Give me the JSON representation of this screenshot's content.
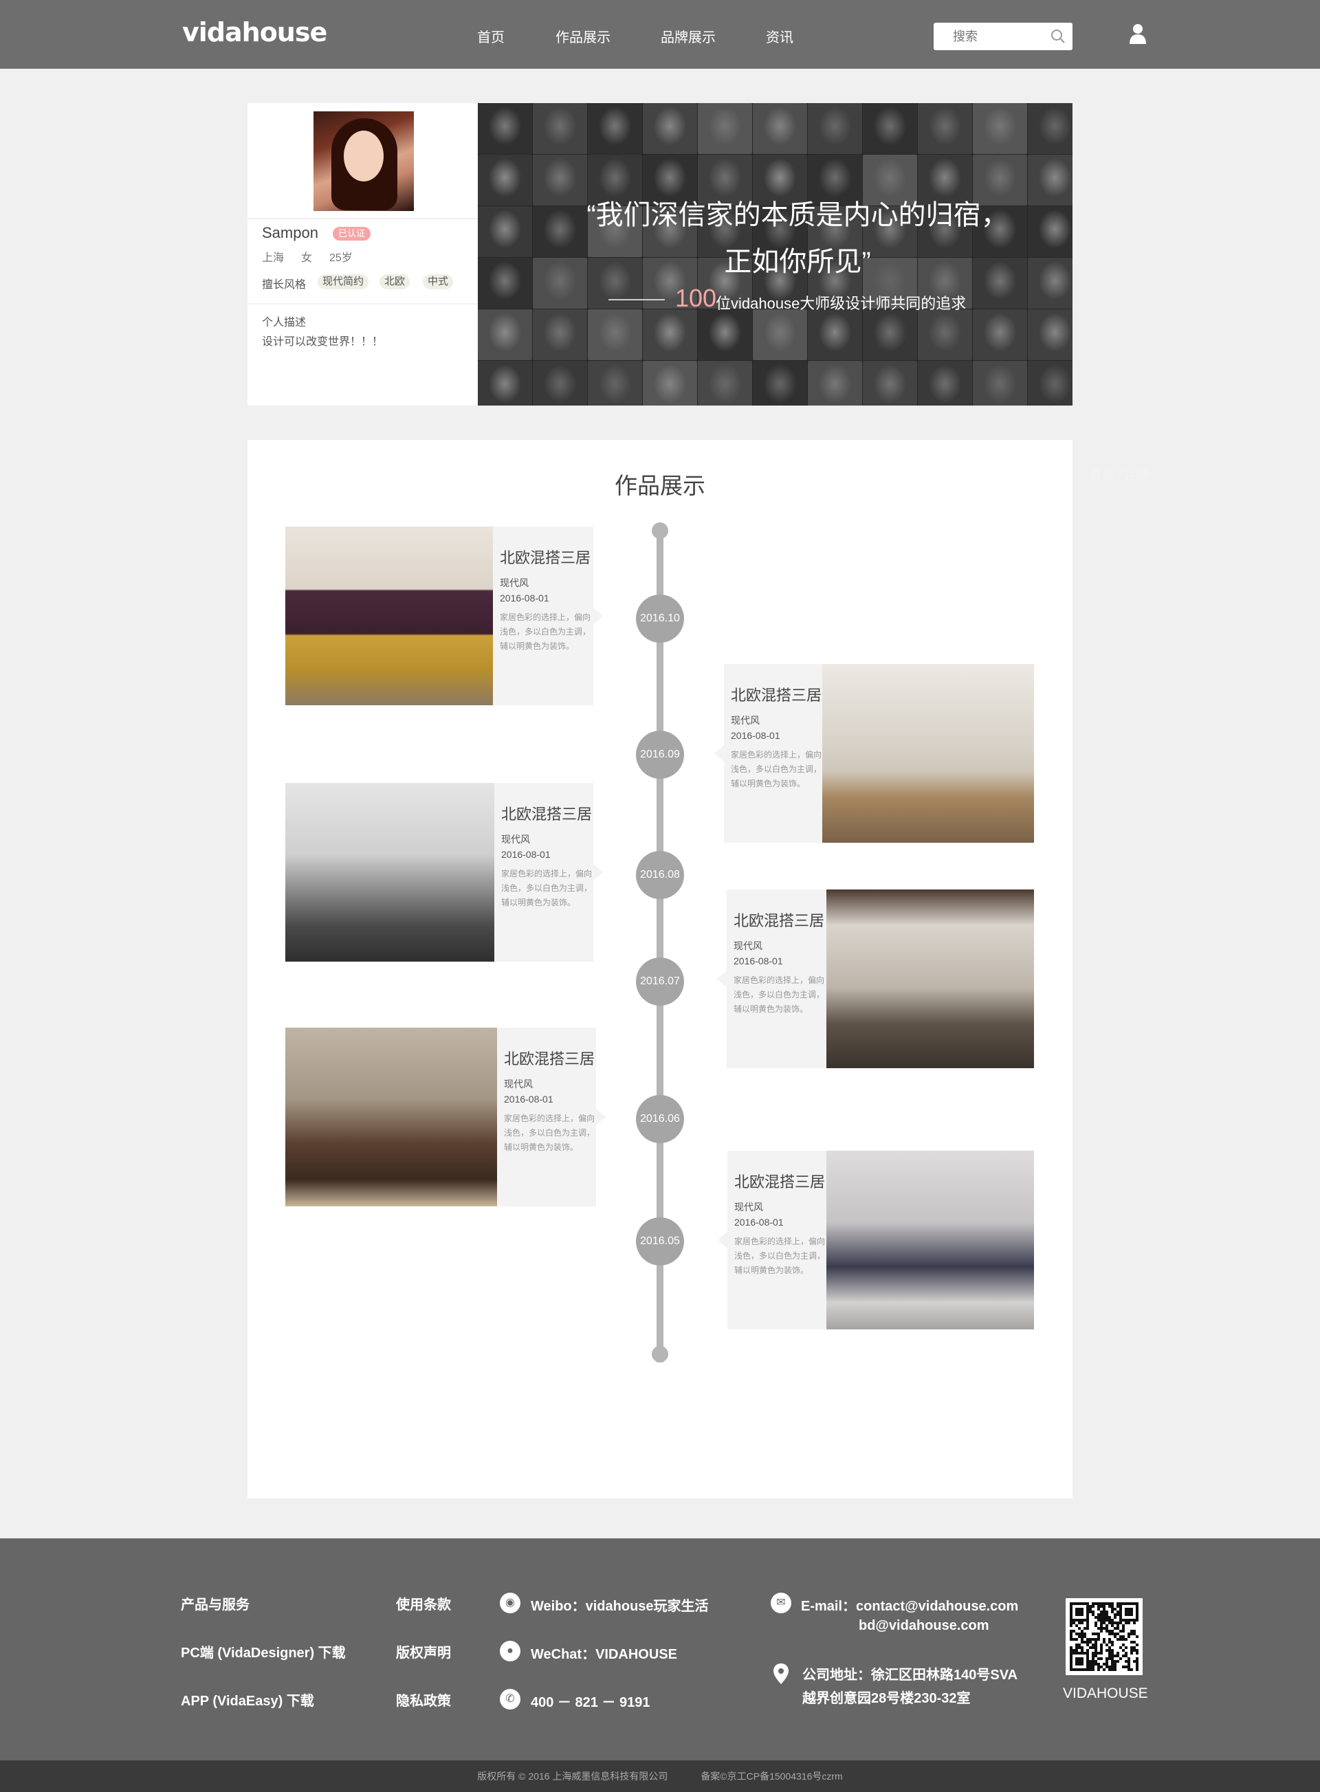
{
  "header": {
    "logo": "vidahouse",
    "nav": [
      "首页",
      "作品展示",
      "品牌展示",
      "资讯"
    ],
    "search_placeholder": "搜索",
    "icons": {
      "search": "search-icon",
      "user": "user-icon"
    }
  },
  "profile": {
    "name": "Sampon",
    "badge": "已认证",
    "city": "上海",
    "gender": "女",
    "age": "25岁",
    "style_label": "擅长风格",
    "tags": [
      "现代简约",
      "北欧",
      "中式"
    ],
    "desc_label": "个人描述",
    "desc": "设计可以改变世界！！！"
  },
  "banner": {
    "quote_line1": "“我们深信家的本质是内心的归宿，",
    "quote_line2": "正如你所见”",
    "sub_number": "100",
    "sub_text": "位vidahouse大师级设计师共同的追求"
  },
  "works": {
    "title": "作品展示",
    "timeline": [
      {
        "date": "2016.10",
        "side": "left",
        "title": "北欧混搭三居",
        "style": "现代风",
        "date_text": "2016-08-01",
        "desc": "家居色彩的选择上，偏向浅色，多以白色为主调，辅以明黄色为装饰。"
      },
      {
        "date": "2016.09",
        "side": "right",
        "title": "北欧混搭三居",
        "style": "现代风",
        "date_text": "2016-08-01",
        "desc": "家居色彩的选择上，偏向浅色，多以白色为主调，辅以明黄色为装饰。"
      },
      {
        "date": "2016.08",
        "side": "left",
        "title": "北欧混搭三居",
        "style": "现代风",
        "date_text": "2016-08-01",
        "desc": "家居色彩的选择上，偏向浅色，多以白色为主调，辅以明黄色为装饰。"
      },
      {
        "date": "2016.07",
        "side": "right",
        "title": "北欧混搭三居",
        "style": "现代风",
        "date_text": "2016-08-01",
        "desc": "家居色彩的选择上，偏向浅色，多以白色为主调，辅以明黄色为装饰。"
      },
      {
        "date": "2016.06",
        "side": "left",
        "title": "北欧混搭三居",
        "style": "现代风",
        "date_text": "2016-08-01",
        "desc": "家居色彩的选择上，偏向浅色，多以白色为主调，辅以明黄色为装饰。"
      },
      {
        "date": "2016.05",
        "side": "right",
        "title": "北欧混搭三居",
        "style": "现代风",
        "date_text": "2016-08-01",
        "desc": "家居色彩的选择上，偏向浅色，多以白色为主调，辅以明黄色为装饰。"
      }
    ]
  },
  "faint_link": "登录 / 注册",
  "footer": {
    "col1": [
      "产品与服务",
      "PC端 (VidaDesigner) 下载",
      "APP (VidaEasy) 下载"
    ],
    "col2": [
      "使用条款",
      "版权声明",
      "隐私政策"
    ],
    "weibo": "Weibo：vidahouse玩家生活",
    "wechat": "WeChat：VIDAHOUSE",
    "phone": "400 － 821 － 9191",
    "email_label": "E-mail：contact@vidahouse.com",
    "email2": "bd@vidahouse.com",
    "address1": "公司地址：徐汇区田林路140号SVA",
    "address2": "越界创意园28号楼230-32室",
    "qr_label": "VIDAHOUSE"
  },
  "copyright": {
    "text1": "版权所有 © 2016 上海威墨信息科技有限公司",
    "text2": "备案©京工CP备15004316号czrm"
  },
  "colors": {
    "header_bg": "#6e6e6e",
    "accent_pink": "#f6a5a5",
    "timeline_gray": "#a5a5a5",
    "footer_bg": "#666666"
  }
}
